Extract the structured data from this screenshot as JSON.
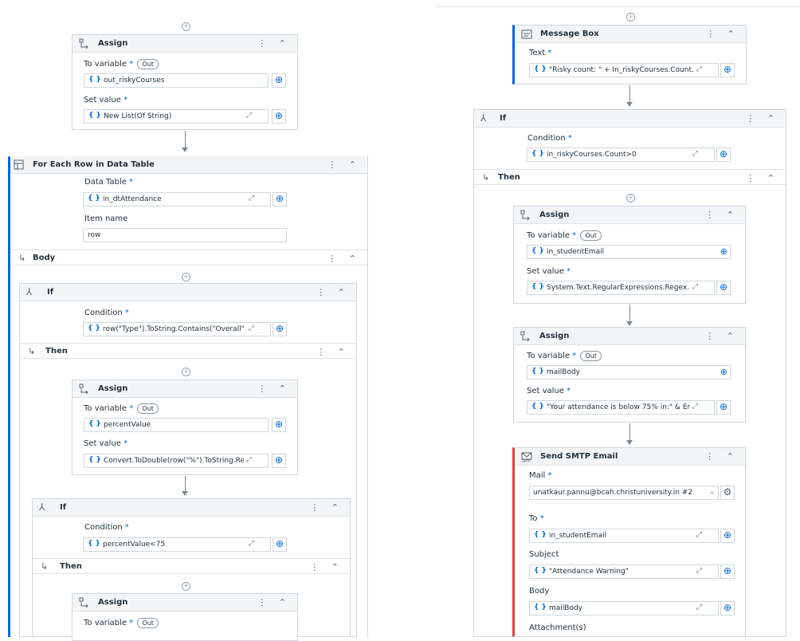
{
  "left": {
    "assign1": {
      "title": "Assign",
      "to_label": "To variable",
      "out": "Out",
      "to_value": "out_riskyCourses",
      "set_label": "Set value",
      "set_value": "New List(Of String)"
    },
    "foreach": {
      "title": "For Each Row in Data Table",
      "datatable_label": "Data Table",
      "datatable_value": "in_dtAttendance",
      "itemname_label": "Item name",
      "itemname_value": "row",
      "body_label": "Body"
    },
    "if1": {
      "title": "If",
      "condition_label": "Condition",
      "condition_value": "row(\"Type\").ToString.Contains(\"Overall\"",
      "then_label": "Then"
    },
    "assign2": {
      "title": "Assign",
      "to_label": "To variable",
      "out": "Out",
      "to_value": "percentValue",
      "set_label": "Set value",
      "set_value": "Convert.ToDouble(row(\"%\").ToString.Rep"
    },
    "if2": {
      "title": "If",
      "condition_label": "Condition",
      "condition_value": "percentValue<75",
      "then_label": "Then"
    },
    "assign3": {
      "title": "Assign",
      "to_label": "To variable",
      "out": "Out"
    }
  },
  "right": {
    "msgbox": {
      "title": "Message Box",
      "text_label": "Text",
      "text_value": "\"Risky count: \" + In_riskyCourses.Count."
    },
    "if": {
      "title": "If",
      "condition_label": "Condition",
      "condition_value": "in_riskyCourses.Count>0",
      "then_label": "Then"
    },
    "assign1": {
      "title": "Assign",
      "to_label": "To variable",
      "out": "Out",
      "to_value": "in_studentEmail",
      "set_label": "Set value",
      "set_value": "System.Text.RegularExpressions.Regex."
    },
    "assign2": {
      "title": "Assign",
      "to_label": "To variable",
      "out": "Out",
      "to_value": "mailBody",
      "set_label": "Set value",
      "set_value": "\"Your attendance is below 75% in:\" & Er"
    },
    "smtp": {
      "title": "Send SMTP Email",
      "mail_label": "Mail",
      "mail_value": "unatkaur.pannu@bcah.christuniversity.in #2",
      "to_label": "To",
      "to_value": "in_studentEmail",
      "subject_label": "Subject",
      "subject_value": "\"Attendance Warning\"",
      "body_label": "Body",
      "body_value": "mailBody",
      "attach_label": "Attachment(s)"
    }
  },
  "icons": {
    "expand": "⤢",
    "plus": "⊕",
    "more": "⋮",
    "collapse": "⌃"
  }
}
